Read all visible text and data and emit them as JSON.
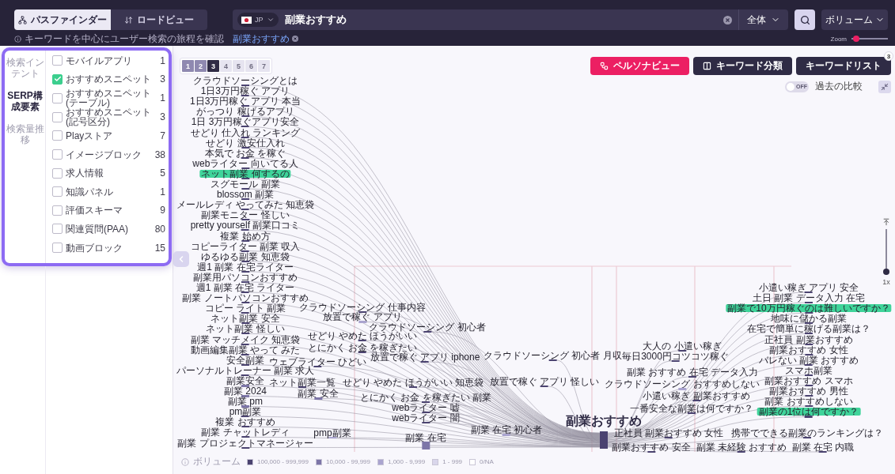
{
  "header": {
    "view_tabs": [
      {
        "label": "パスファインダー",
        "selected": true
      },
      {
        "label": "ロードビュー",
        "selected": false
      }
    ],
    "hint": "キーワードを中心にユーザー検索の旅程を確認",
    "search": {
      "country": "JP",
      "value": "副業おすすめ",
      "scope": "全体"
    },
    "recent_keywords": [
      "副業おすすめ"
    ],
    "sort": "ボリューム",
    "zoom": {
      "label": "Zoom",
      "level": 0.05
    }
  },
  "sidebar": {
    "tabs": [
      {
        "label": "検索インテント",
        "selected": false
      },
      {
        "label": "SERP構成要素",
        "selected": true
      },
      {
        "label": "検索量推移",
        "selected": false
      }
    ],
    "filters": [
      {
        "label": "モバイルアプリ",
        "count": "1",
        "checked": false
      },
      {
        "label": "おすすめスニペット",
        "count": "3",
        "checked": true
      },
      {
        "label": "おすすめスニペット(テーブル)",
        "count": "1",
        "checked": false
      },
      {
        "label": "おすすめスニペット(記号区分)",
        "count": "3",
        "checked": false
      },
      {
        "label": "Playストア",
        "count": "7",
        "checked": false
      },
      {
        "label": "イメージブロック",
        "count": "38",
        "checked": false
      },
      {
        "label": "求人情報",
        "count": "5",
        "checked": false
      },
      {
        "label": "知識パネル",
        "count": "1",
        "checked": false
      },
      {
        "label": "評価スキーマ",
        "count": "9",
        "checked": false
      },
      {
        "label": "関連質問(PAA)",
        "count": "80",
        "checked": false
      },
      {
        "label": "動画ブロック",
        "count": "15",
        "checked": false
      }
    ]
  },
  "pager": [
    {
      "label": "1",
      "selected": false
    },
    {
      "label": "2",
      "selected": false
    },
    {
      "label": "3",
      "selected": true
    },
    {
      "label": "4",
      "selected": false
    },
    {
      "label": "5",
      "selected": false
    },
    {
      "label": "6",
      "selected": false
    },
    {
      "label": "7",
      "selected": false
    }
  ],
  "actions": [
    {
      "label": "ペルソナビュー",
      "kind": "accent"
    },
    {
      "label": "キーワード分類",
      "kind": "dark"
    },
    {
      "label": "キーワードリスト",
      "kind": "dark",
      "badge": "3"
    }
  ],
  "compare": {
    "state": "OFF",
    "on": false,
    "label": "過去の比較"
  },
  "vertical_zoom": {
    "level": 0,
    "label": "1x"
  },
  "flow": {
    "center": {
      "label": "副業おすすめ",
      "color": "#4b4370"
    },
    "before_columns": [
      {
        "nodes": [
          {
            "label": "クラウドソーシングとは",
            "highlighted": false,
            "kind": "line",
            "color": "#4b4370"
          },
          {
            "label": "1日3万円稼ぐ アプリ",
            "highlighted": false,
            "kind": "line",
            "color": "#4b4370"
          },
          {
            "label": "1日3万円稼ぐ アプリ 本当",
            "highlighted": false,
            "kind": "line",
            "color": "#4b4370"
          },
          {
            "label": "がっつり 稼げるアプリ",
            "highlighted": false,
            "kind": "line",
            "color": "#4b4370"
          },
          {
            "label": "1日 3万円稼ぐアプリ安全",
            "highlighted": false,
            "kind": "line",
            "color": "#4b4370"
          },
          {
            "label": "せどり 仕入れ ランキング",
            "highlighted": false,
            "kind": "line",
            "color": "#4b4370"
          },
          {
            "label": "せどり 激安仕入れ",
            "highlighted": false,
            "kind": "line",
            "color": "#4b4370"
          },
          {
            "label": "本気で お金 を稼ぐ",
            "highlighted": false,
            "kind": "line",
            "color": "#4b4370"
          },
          {
            "label": "webライター 向いてる人",
            "highlighted": false,
            "kind": "line",
            "color": "#4b4370"
          },
          {
            "label": "ネット副業 何するの",
            "highlighted": true,
            "kind": "line",
            "color": "#4b4370"
          },
          {
            "label": "スグモール 副業",
            "highlighted": false,
            "kind": "line",
            "color": "#4b4370"
          },
          {
            "label": "blossom 副業",
            "highlighted": false,
            "kind": "line",
            "color": "#4b4370"
          },
          {
            "label": "メールレディ やってみた 知恵袋",
            "highlighted": false,
            "kind": "line",
            "color": "#4b4370"
          },
          {
            "label": "副業モニター 怪しい",
            "highlighted": false,
            "kind": "line",
            "color": "#4b4370"
          },
          {
            "label": "pretty yourself 副業口コミ",
            "highlighted": false,
            "kind": "line",
            "color": "#4b4370"
          },
          {
            "label": "複業 始め方",
            "highlighted": false,
            "kind": "line",
            "color": "#4b4370"
          },
          {
            "label": "コピーライター 副業 収入",
            "highlighted": false,
            "kind": "line",
            "color": "#4b4370"
          },
          {
            "label": "ゆるゆる副業 知恵袋",
            "highlighted": false,
            "kind": "line",
            "color": "#4b4370"
          },
          {
            "label": "週1 副業 在宅ライター",
            "highlighted": false,
            "kind": "line",
            "color": "#4b4370"
          },
          {
            "label": "副業用パソコンおすすめ",
            "highlighted": false,
            "kind": "line",
            "color": "#4b4370"
          },
          {
            "label": "週1 副業 在宅 ライター",
            "highlighted": false,
            "kind": "line",
            "color": "#4b4370"
          },
          {
            "label": "副業 ノートパソコンおすすめ",
            "highlighted": false,
            "kind": "line",
            "color": "#4b4370"
          },
          {
            "label": "コピー ライト 副業",
            "highlighted": false,
            "kind": "line",
            "color": "#4b4370"
          },
          {
            "label": "ネット副業 安全",
            "highlighted": false,
            "kind": "line",
            "color": "#4b4370"
          },
          {
            "label": "ネット副業 怪しい",
            "highlighted": false,
            "kind": "line",
            "color": "#4b4370"
          },
          {
            "label": "副業 マッチメイク 知恵袋",
            "highlighted": false,
            "kind": "line",
            "color": "#4b4370"
          },
          {
            "label": "動画編集副業 やって みた",
            "highlighted": false,
            "kind": "line",
            "color": "#4b4370"
          },
          {
            "label": "安全副業",
            "highlighted": false,
            "kind": "line",
            "color": "#4b4370"
          },
          {
            "label": "パーソナルトレーナー 副業 求人",
            "highlighted": false,
            "kind": "line",
            "color": "#4b4370"
          },
          {
            "label": "副業安全",
            "highlighted": false,
            "kind": "bar",
            "color": "#7d76a8"
          },
          {
            "label": "副業 2024",
            "highlighted": false,
            "kind": "bar",
            "color": "#7d76a8"
          },
          {
            "label": "副業 pm",
            "highlighted": false,
            "kind": "bar",
            "color": "#7d76a8"
          },
          {
            "label": "pm副業",
            "highlighted": false,
            "kind": "line",
            "color": "#4b4370"
          },
          {
            "label": "複業 おすすめ",
            "highlighted": false,
            "kind": "line",
            "color": "#4b4370"
          },
          {
            "label": "副業 チャットレディ",
            "highlighted": false,
            "kind": "line",
            "color": "#4b4370"
          },
          {
            "label": "副業 プロジェクトマネージャー",
            "highlighted": false,
            "kind": "line",
            "color": "#4b4370"
          }
        ]
      },
      {
        "nodes": [
          {
            "label": "クラウドソーシング 仕事内容",
            "highlighted": false,
            "kind": "line",
            "color": "#4b4370"
          },
          {
            "label": "放置で稼ぐ アプリ",
            "highlighted": false,
            "kind": "bar",
            "color": "#aaa4cf"
          },
          {
            "label": "せどり やめた ほうがいい",
            "highlighted": false,
            "kind": "line",
            "color": "#4b4370"
          },
          {
            "label": "とにかく お金 を稼ぎたい",
            "highlighted": false,
            "kind": "line",
            "color": "#4b4370"
          },
          {
            "label": "ウェブライター ひどい",
            "highlighted": false,
            "kind": "line",
            "color": "#4b4370"
          },
          {
            "label": "ネット副業一覧",
            "highlighted": false,
            "kind": "line",
            "color": "#4b4370"
          },
          {
            "label": "副業 安全",
            "highlighted": false,
            "kind": "bar",
            "color": "#7d76a8"
          },
          {
            "label": "pmp副業",
            "highlighted": false,
            "kind": "line",
            "color": "#aaa4cf"
          }
        ]
      },
      {
        "nodes": [
          {
            "label": "クラウドソーシング 初心者",
            "highlighted": false,
            "kind": "line",
            "color": "#4b4370"
          },
          {
            "label": "放置で稼ぐ アプリ iphone",
            "highlighted": false,
            "kind": "line",
            "color": "#4b4370"
          },
          {
            "label": "せどり やめた ほうがいい 知恵袋",
            "highlighted": false,
            "kind": "line",
            "color": "#4b4370"
          },
          {
            "label": "とにかく お金 を稼ぎたい 副業",
            "highlighted": false,
            "kind": "line",
            "color": "#4b4370"
          },
          {
            "label": "webライター 嘘",
            "highlighted": false,
            "kind": "line",
            "color": "#4b4370"
          },
          {
            "label": "webライター 闇",
            "highlighted": false,
            "kind": "line",
            "color": "#4b4370"
          },
          {
            "label": "副業 在宅",
            "highlighted": false,
            "kind": "block",
            "color": "#7d76a8"
          }
        ]
      },
      {
        "nodes": [
          {
            "label": "クラウドソーシング 初心者 月収",
            "highlighted": false,
            "kind": "line",
            "color": "#4b4370"
          },
          {
            "label": "放置で稼ぐ アプリ 怪しい",
            "highlighted": false,
            "kind": "line",
            "color": "#4b4370"
          },
          {
            "label": "副業 在宅 初心者",
            "highlighted": false,
            "kind": "bar",
            "color": "#aaa4cf"
          }
        ]
      },
      {
        "nodes": [
          {
            "label": "クラウドソーシング おすすめしない",
            "highlighted": false,
            "kind": "bar",
            "color": "#aaa4cf"
          }
        ]
      }
    ],
    "after_columns": [
      {
        "nodes": [
          {
            "label": "副業 おすすめ 在宅 データ入力",
            "highlighted": false,
            "kind": "line",
            "color": "#4b4370"
          },
          {
            "label": "小遣い稼ぎ 副業おすすめ",
            "highlighted": false,
            "kind": "line",
            "color": "#4b4370"
          },
          {
            "label": "一番安全な副業は何ですか？",
            "highlighted": false,
            "kind": "line",
            "color": "#4b4370"
          },
          {
            "label": "正社員 副業おすすめ 女性",
            "highlighted": false,
            "kind": "line",
            "color": "#4b4370"
          },
          {
            "label": "副業おすすめ 安全",
            "highlighted": false,
            "kind": "line",
            "color": "#4b4370"
          }
        ]
      },
      {
        "nodes": [
          {
            "label": "大人の 小遣い稼ぎ",
            "highlighted": false,
            "kind": "line",
            "color": "#4b4370"
          },
          {
            "label": "毎日3000円コツコツ稼ぐ",
            "highlighted": false,
            "kind": "line",
            "color": "#4b4370"
          },
          {
            "label": "携帯でできる副業のランキングは？",
            "highlighted": false,
            "kind": "line",
            "color": "#4b4370"
          },
          {
            "label": "副業 未経験 おすすめ",
            "highlighted": false,
            "kind": "line",
            "color": "#4b4370"
          }
        ]
      },
      {
        "nodes": [
          {
            "label": "小遣い稼ぎ アプリ 安全",
            "highlighted": false,
            "kind": "line",
            "color": "#4b4370"
          },
          {
            "label": "土日 副業 データ入力 在宅",
            "highlighted": false,
            "kind": "line",
            "color": "#4b4370"
          },
          {
            "label": "副業で10万円稼ぐのは難しいですか？",
            "highlighted": true,
            "kind": "line",
            "color": "#4b4370"
          },
          {
            "label": "地味に儲かる副業",
            "highlighted": false,
            "kind": "line",
            "color": "#4b4370"
          },
          {
            "label": "在宅で簡単に稼げる副業は？",
            "highlighted": false,
            "kind": "line",
            "color": "#4b4370"
          },
          {
            "label": "正社員 副業おすすめ",
            "highlighted": false,
            "kind": "line",
            "color": "#4b4370"
          },
          {
            "label": "副業おすすめ 女性",
            "highlighted": false,
            "kind": "line",
            "color": "#4b4370"
          },
          {
            "label": "バレない 副業 おすすめ",
            "highlighted": false,
            "kind": "line",
            "color": "#4b4370"
          },
          {
            "label": "スマホ副業",
            "highlighted": false,
            "kind": "line",
            "color": "#4b4370"
          },
          {
            "label": "副業おすすめ スマホ",
            "highlighted": false,
            "kind": "line",
            "color": "#4b4370"
          },
          {
            "label": "副業おすすめ 男性",
            "highlighted": false,
            "kind": "line",
            "color": "#4b4370"
          },
          {
            "label": "副業 おすすめしない",
            "highlighted": false,
            "kind": "line",
            "color": "#4b4370"
          },
          {
            "label": "副業の1位は何ですか？",
            "highlighted": true,
            "kind": "bar",
            "color": "#4b4370"
          },
          {
            "label": "副業 在宅 内職",
            "highlighted": false,
            "kind": "line",
            "color": "#4b4370"
          }
        ]
      }
    ]
  },
  "legend": {
    "title": "ボリューム",
    "items": [
      {
        "label": "100,000 - 999,999",
        "color": "#4b4370"
      },
      {
        "label": "10,000 - 99,999",
        "color": "#7d76a8"
      },
      {
        "label": "1,000 - 9,999",
        "color": "#aaa4cf"
      },
      {
        "label": "1 - 999",
        "color": "#d9d6eb"
      },
      {
        "label": "0/NA",
        "color": "#ffffff"
      }
    ]
  }
}
